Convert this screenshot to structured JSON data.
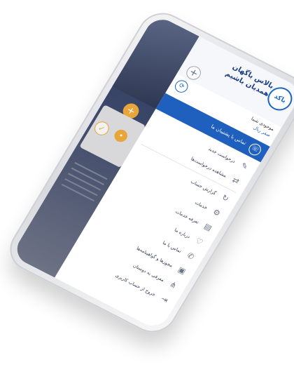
{
  "app": {
    "brand_line1": "بالاس یاگهان",
    "brand_line2": "همدیان باشیم",
    "logo_text": "ياكد"
  },
  "user": {
    "name": "موجودی شما",
    "balance": "صفر ریال"
  },
  "active_item": {
    "label": "تماس با پشتیبان ما",
    "icon": "headset-icon"
  },
  "menu": [
    {
      "label": "درخواست جدید",
      "icon": "new-request-icon"
    },
    {
      "label": "مشاهده درخواست‌ها",
      "icon": "requests-icon"
    },
    {
      "label": "گزارش حساب",
      "icon": "report-icon"
    },
    {
      "label": "خدمات",
      "icon": "services-icon"
    },
    {
      "label": "تعرفه خدمات",
      "icon": "tariff-icon"
    },
    {
      "label": "درباره ما",
      "icon": "about-icon"
    },
    {
      "label": "تماس با ما",
      "icon": "phone-icon"
    },
    {
      "label": "مجوزها و گواهینامه‌ها",
      "icon": "certificate-icon"
    },
    {
      "label": "معرفی به دوستان",
      "icon": "share-icon"
    },
    {
      "label": "خروج از حساب کاربری",
      "icon": "logout-icon"
    }
  ],
  "colors": {
    "primary": "#1f5fbd",
    "accent": "#e8a63a",
    "brand_text": "#1a3e8a"
  }
}
